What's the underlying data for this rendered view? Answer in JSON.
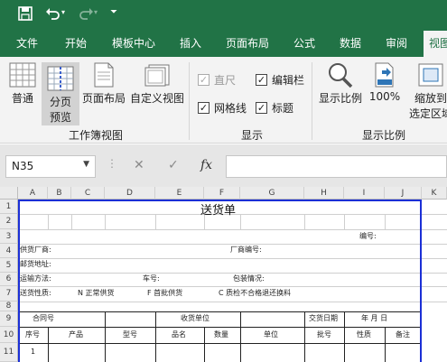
{
  "qat": {
    "save": "save-icon",
    "undo": "undo-icon",
    "redo": "redo-icon",
    "customize": "customize-icon"
  },
  "tabs": [
    "文件",
    "开始",
    "模板中心",
    "插入",
    "页面布局",
    "公式",
    "数据",
    "审阅",
    "视图"
  ],
  "ribbon": {
    "views": [
      {
        "label": "普通"
      },
      {
        "label1": "分页",
        "label2": "预览"
      },
      {
        "label": "页面布局"
      },
      {
        "label": "自定义视图"
      }
    ],
    "group_views": "工作簿视图",
    "show": {
      "ruler": "直尺",
      "formula_bar": "编辑栏",
      "gridlines": "网格线",
      "headings": "标题",
      "check": "✓"
    },
    "group_show": "显示",
    "zoom": {
      "zoom": "显示比例",
      "percent": "100%",
      "sel1": "缩放到",
      "sel2": "选定区域"
    },
    "group_zoom": "显示比例"
  },
  "formula_bar": {
    "name_box": "N35",
    "cancel": "✕",
    "enter": "✓",
    "fx": "fx",
    "value": ""
  },
  "columns": [
    "A",
    "B",
    "C",
    "D",
    "E",
    "F",
    "G",
    "H",
    "I",
    "J",
    "K"
  ],
  "rows": [
    "1",
    "2",
    "3",
    "4",
    "5",
    "6",
    "7",
    "8",
    "9",
    "10",
    "11"
  ],
  "sheet": {
    "title": "送货单",
    "number_label": "编号:",
    "supplier": "供货厂商:",
    "supplier_no": "厂商编号:",
    "address": "邮货地址:",
    "shipping": "运输方法:",
    "vehicle": "车号:",
    "packing": "包装情况:",
    "nature": "送货性质:",
    "opt_n": "N 正常供货",
    "opt_f": "F 首批供货",
    "opt_c": "C 质检不合格退还换料",
    "contract_no": "合同号",
    "receiver": "收货单位",
    "delivery_date": "交货日期",
    "ymd": "年    月    日",
    "headers": [
      "序号",
      "产品",
      "型号",
      "品名",
      "数量",
      "单位",
      "批号",
      "性质",
      "备注"
    ],
    "row11_no": "1"
  }
}
